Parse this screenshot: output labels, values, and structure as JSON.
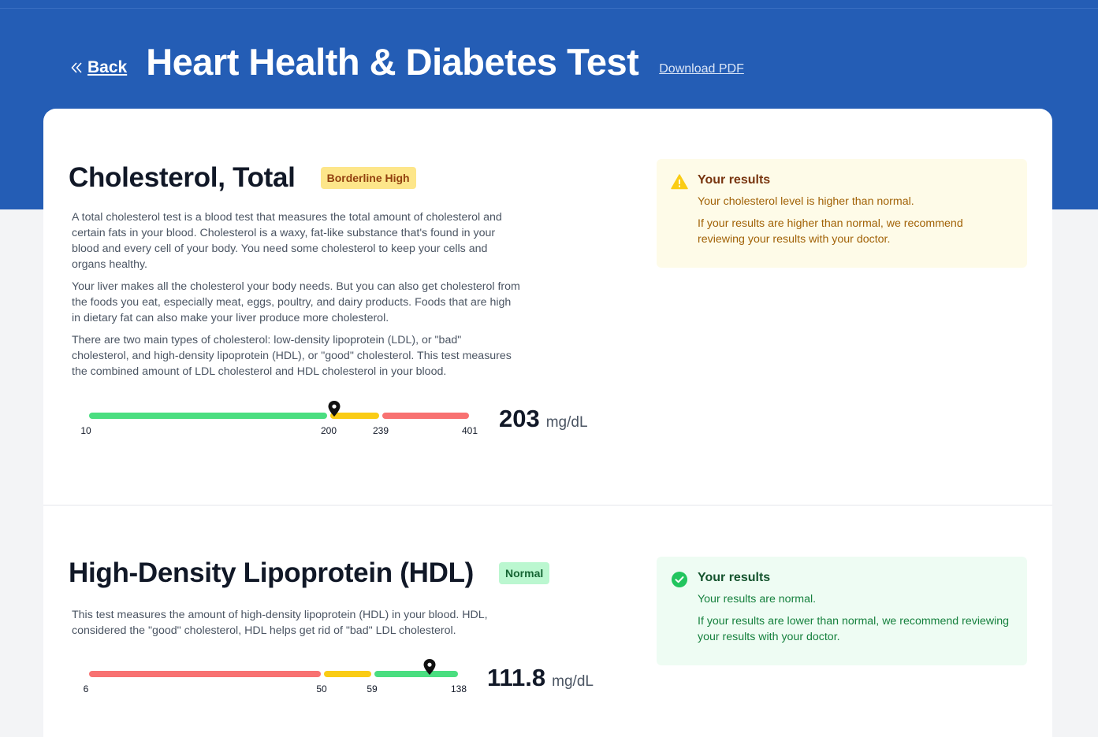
{
  "header": {
    "back_label": "Back",
    "title": "Heart Health & Diabetes Test",
    "pdf_label": "Download PDF"
  },
  "tests": [
    {
      "title": "Cholesterol, Total",
      "badge": "Borderline High",
      "description": [
        "A total cholesterol test is a blood test that measures the total amount of cholesterol and certain fats in your blood. Cholesterol is a waxy, fat-like substance that's found in your blood and every cell of your body. You need some cholesterol to keep your cells and organs healthy.",
        "Your liver makes all the cholesterol your body needs. But you can also get cholesterol from the foods you eat, especially meat, eggs, poultry, and dairy products. Foods that are high in dietary fat can also make your liver produce more cholesterol.",
        "There are two main types of cholesterol: low-density lipoprotein (LDL), or \"bad\" cholesterol, and high-density lipoprotein (HDL), or \"good\" cholesterol. This test measures the combined amount of LDL cholesterol and HDL cholesterol in your blood."
      ],
      "gauge": {
        "ticks": [
          "10",
          "200",
          "239",
          "401"
        ],
        "segment_colors": [
          "#4ade80",
          "#facc15",
          "#f87171"
        ],
        "marker_value": 203
      },
      "value": "203",
      "unit": "mg/dL",
      "alert": {
        "status": "warning",
        "icon": "warning-triangle-icon",
        "title": "Your results",
        "line1": "Your cholesterol level is higher than normal.",
        "line2": "If your results are higher than normal, we recommend reviewing your results with your doctor."
      }
    },
    {
      "title": "High-Density Lipoprotein (HDL)",
      "badge": "Normal",
      "description": [
        "This test measures the amount of high-density lipoprotein (HDL) in your blood. HDL, considered the \"good\" cholesterol, HDL helps get rid of \"bad\" LDL cholesterol."
      ],
      "gauge": {
        "ticks": [
          "6",
          "50",
          "59",
          "138"
        ],
        "segment_colors": [
          "#f87171",
          "#facc15",
          "#4ade80"
        ],
        "marker_value": 111.8
      },
      "value": "111.8",
      "unit": "mg/dL",
      "alert": {
        "status": "normal",
        "icon": "check-circle-icon",
        "title": "Your results",
        "line1": "Your results are normal.",
        "line2": "If your results are lower than normal, we recommend reviewing your results with your doctor."
      }
    }
  ],
  "colors": {
    "brand_blue": "#245db5",
    "warning_bg": "#fefbe8",
    "normal_bg": "#eefcf3"
  }
}
